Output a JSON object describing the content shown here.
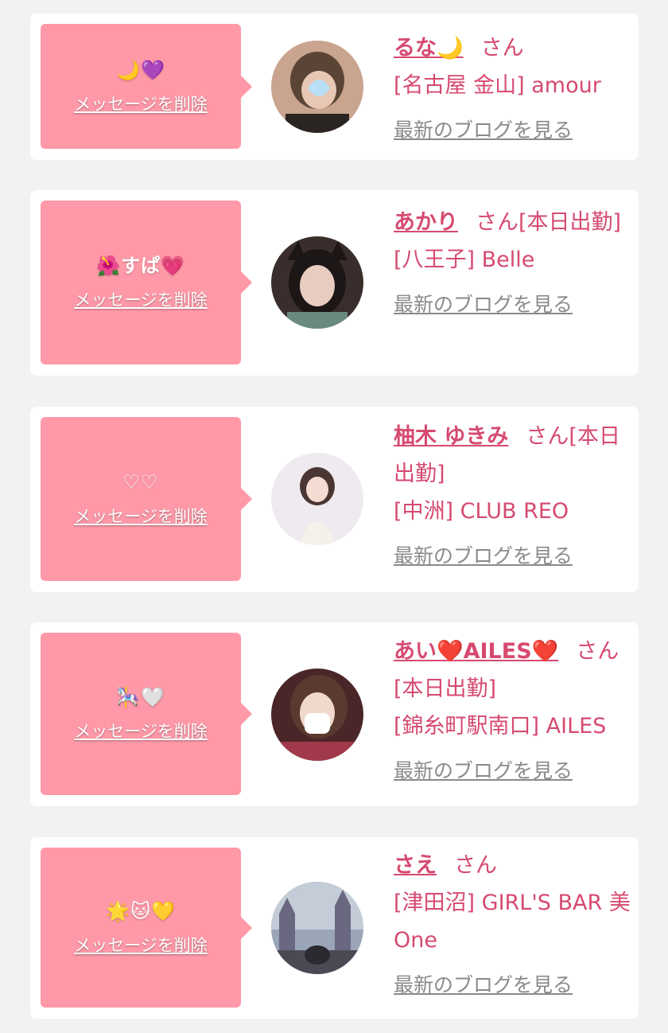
{
  "items": [
    {
      "message": "🌙💜",
      "delete_label": "メッセージを削除",
      "name": "るな🌙",
      "san": "さん",
      "status": "",
      "shop": "[名古屋 金山] amour",
      "blog_label": "最新のブログを見る",
      "avatar_bg": "#c9a48f"
    },
    {
      "message": "🌺すぱ💗",
      "delete_label": "メッセージを削除",
      "name": "あかり",
      "san": "さん",
      "status": "[本日出勤]",
      "shop": "[八王子] Belle",
      "blog_label": "最新のブログを見る",
      "avatar_bg": "#3a2e2c"
    },
    {
      "message": "♡♡",
      "delete_label": "メッセージを削除",
      "name": "柚木 ゆきみ",
      "san": "さん",
      "status": "[本日出勤]",
      "shop": "[中洲] CLUB REO",
      "blog_label": "最新のブログを見る",
      "avatar_bg": "#eeeaf0"
    },
    {
      "message": "🎠🤍",
      "delete_label": "メッセージを削除",
      "name": "あい❤️AILES❤️",
      "san": "さん",
      "status": "[本日出勤]",
      "shop": "[錦糸町駅南口] AILES",
      "blog_label": "最新のブログを見る",
      "avatar_bg": "#4a2628"
    },
    {
      "message": "🌟🐱💛",
      "delete_label": "メッセージを削除",
      "name": "さえ",
      "san": "さん",
      "status": "",
      "shop": "[津田沼] GIRL'S BAR 美One",
      "blog_label": "最新のブログを見る",
      "avatar_bg": "#9aa5b8"
    }
  ]
}
